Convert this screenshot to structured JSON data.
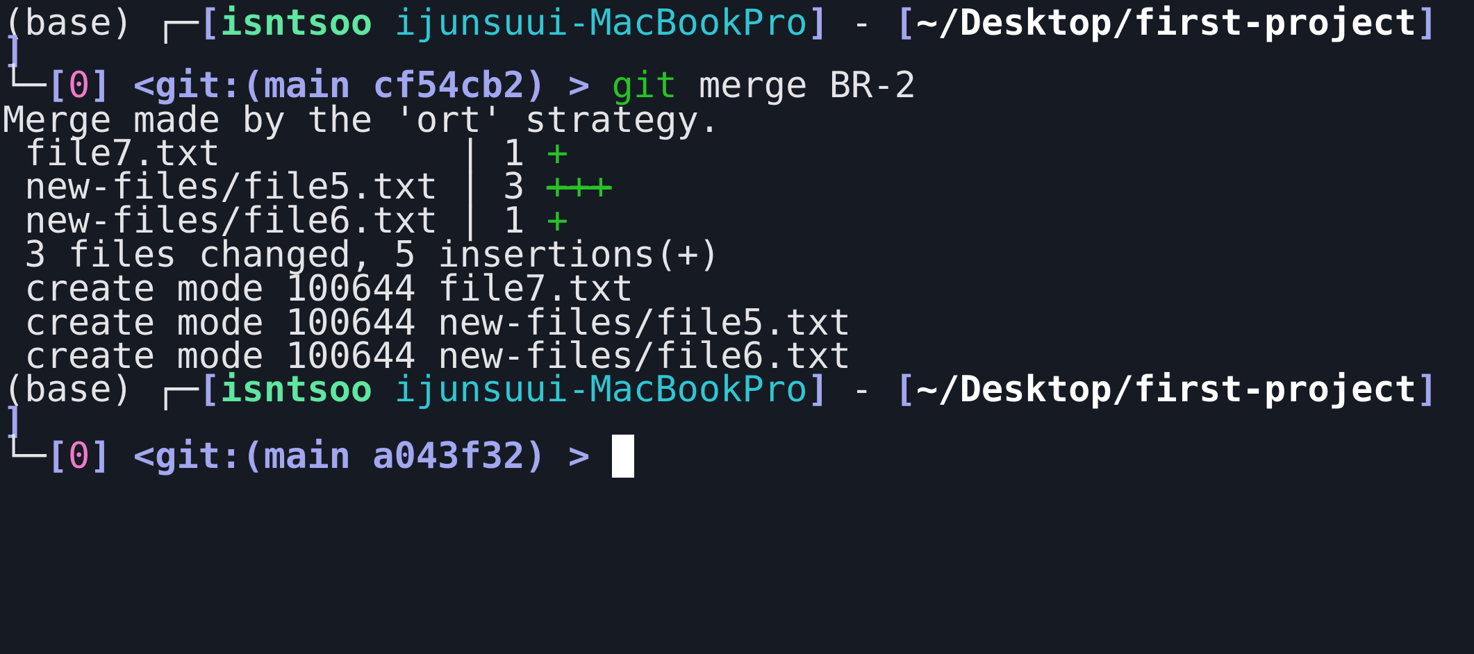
{
  "prompt1": {
    "env": "(base)",
    "corner_top": "┌─",
    "bracket_open": "[",
    "user": "isntsoo",
    "host": "ijunsuui-MacBookPro",
    "bracket_close": "]",
    "sep": "-",
    "path_open": "[",
    "path": "~/Desktop/first-project",
    "path_close": "]",
    "wrap_bracket": "]",
    "corner_bottom": "└─",
    "exit_code_open": "[",
    "exit_code": "0",
    "exit_code_close": "]",
    "git_status": "<git:(main cf54cb2) >",
    "cmd_git": "git",
    "cmd_args": "merge BR-2"
  },
  "output": {
    "merge_msg": "Merge made by the 'ort' strategy.",
    "files": [
      {
        "name": " file7.txt           ",
        "count": "| 1",
        "plus": "+"
      },
      {
        "name": " new-files/file5.txt ",
        "count": "| 3",
        "plus": "+++"
      },
      {
        "name": " new-files/file6.txt ",
        "count": "| 1",
        "plus": "+"
      }
    ],
    "summary": " 3 files changed, 5 insertions(+)",
    "create_modes": [
      " create mode 100644 file7.txt",
      " create mode 100644 new-files/file5.txt",
      " create mode 100644 new-files/file6.txt"
    ]
  },
  "prompt2": {
    "env": "(base)",
    "corner_top": "┌─",
    "bracket_open": "[",
    "user": "isntsoo",
    "host": "ijunsuui-MacBookPro",
    "bracket_close": "]",
    "sep": "-",
    "path_open": "[",
    "path": "~/Desktop/first-project",
    "path_close": "]",
    "wrap_bracket": "]",
    "corner_bottom": "└─",
    "exit_code_open": "[",
    "exit_code": "0",
    "exit_code_close": "]",
    "git_status": "<git:(main a043f32) >"
  },
  "colors": {
    "background": "#161a23",
    "prompt_purple": "#a3a7f0",
    "user_green": "#5fe6a0",
    "host_cyan": "#2fc7d2",
    "exit_pink": "#f07ac8",
    "diff_green": "#27c227"
  }
}
